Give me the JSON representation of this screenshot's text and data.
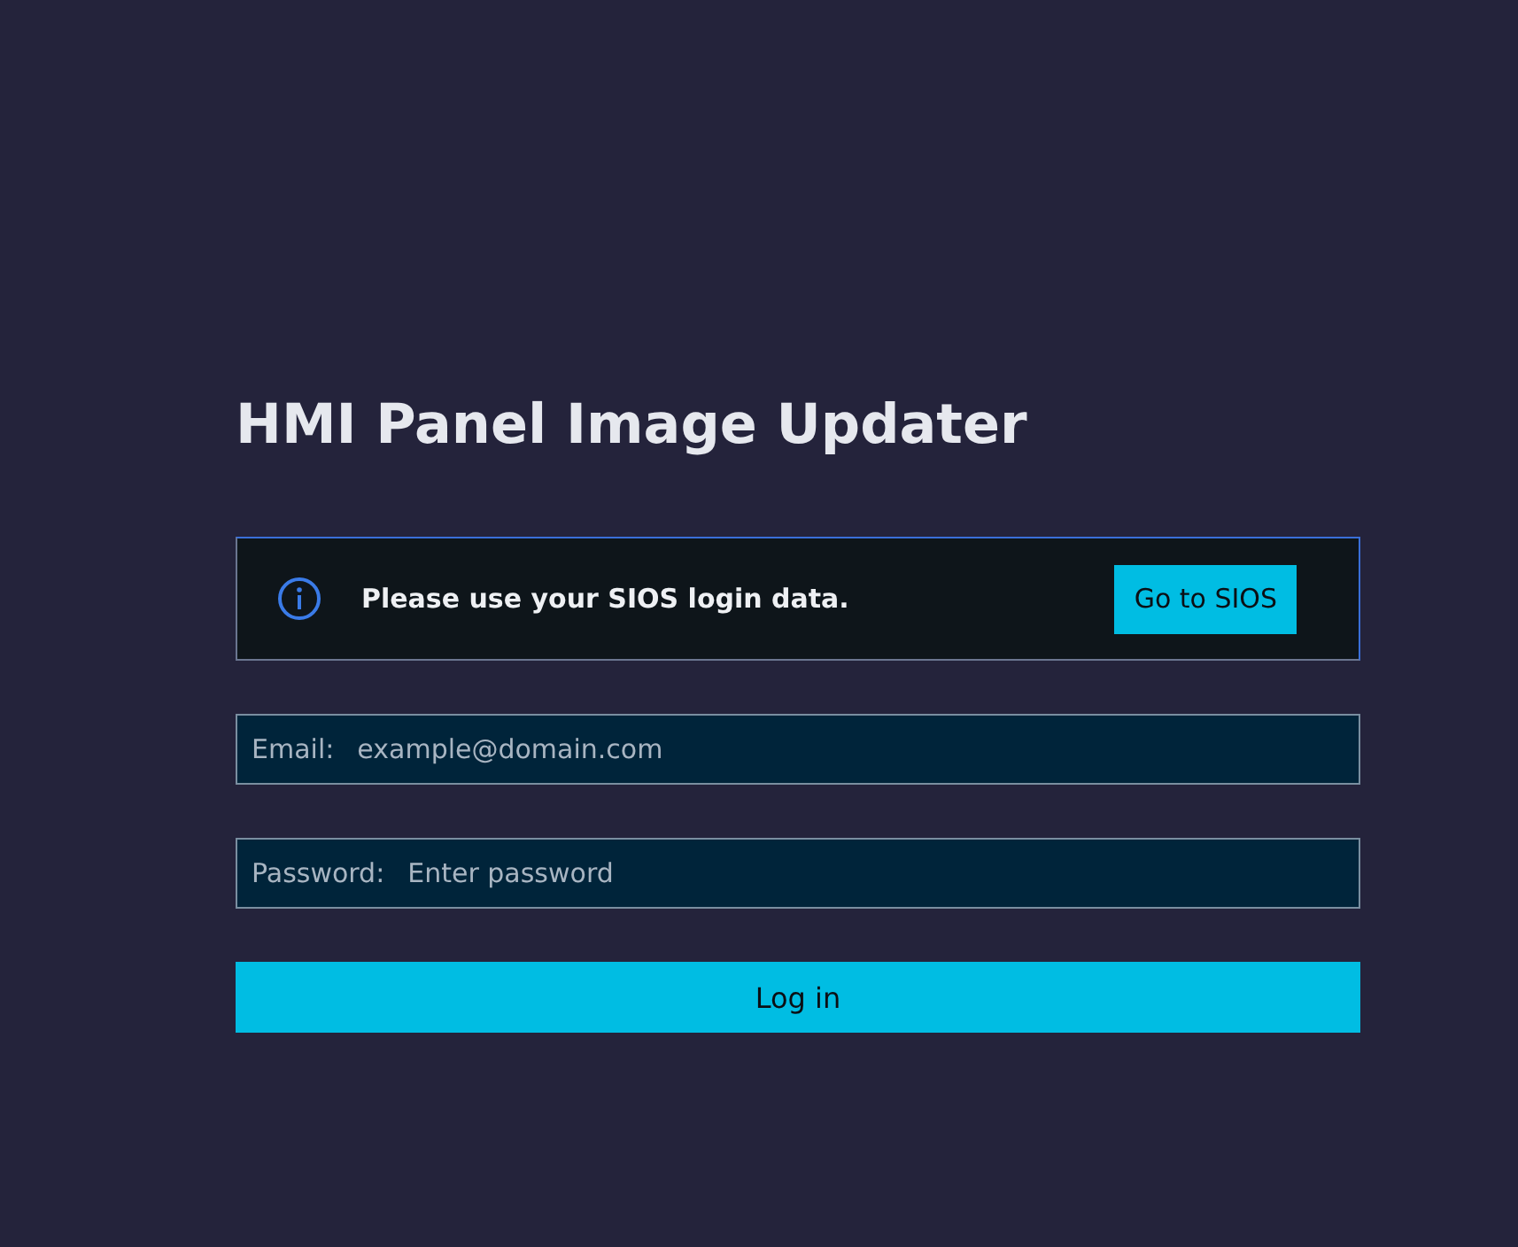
{
  "title": "HMI Panel Image Updater",
  "notice": {
    "text": "Please use your SIOS login data.",
    "button": "Go to SIOS"
  },
  "fields": [
    {
      "label": "Email:",
      "placeholder": "example@domain.com"
    },
    {
      "label": "Password:",
      "placeholder": "Enter password"
    }
  ],
  "submit": "Log in"
}
